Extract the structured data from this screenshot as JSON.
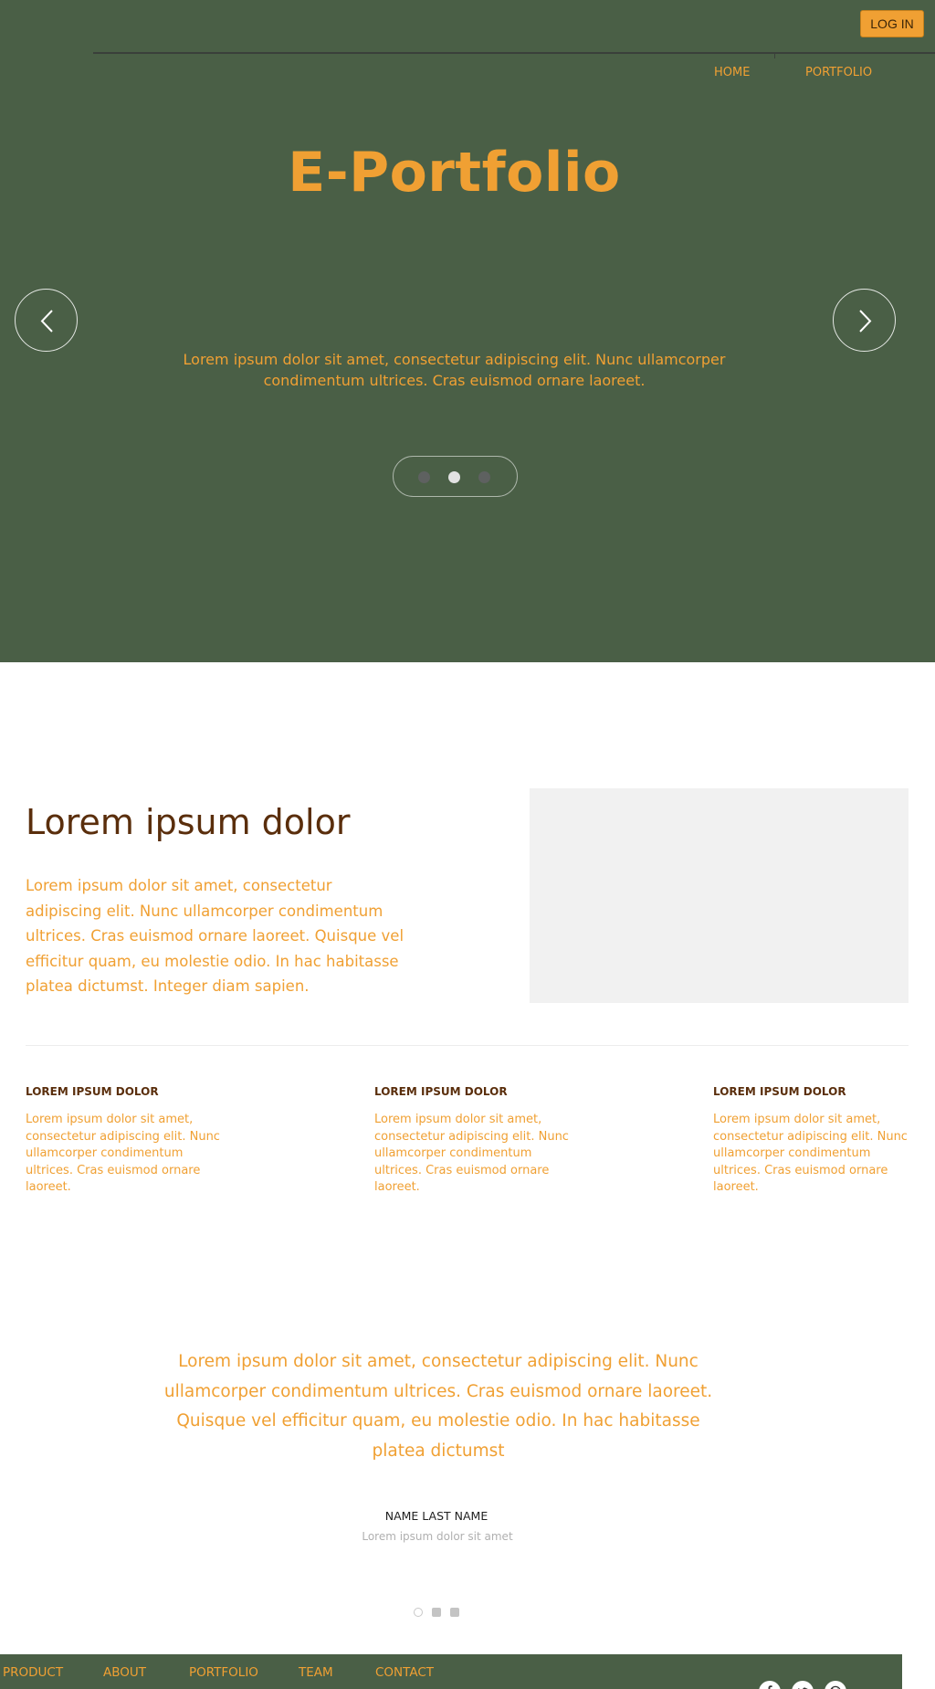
{
  "header": {
    "login_label": "LOG IN",
    "nav": [
      {
        "label": "HOME"
      },
      {
        "label": "PORTFOLIO"
      }
    ]
  },
  "hero": {
    "title": "E-Portfolio",
    "text": "Lorem ipsum dolor sit amet, consectetur adipiscing elit. Nunc ullamcorper condimentum ultrices. Cras euismod ornare laoreet.",
    "prev_icon": "chevron-left-icon",
    "next_icon": "chevron-right-icon",
    "slides_total": 3,
    "active_slide": 2
  },
  "intro": {
    "title": "Lorem ipsum dolor",
    "text": "Lorem ipsum dolor sit amet, consectetur adipiscing elit. Nunc ullamcorper condimentum ultrices. Cras euismod ornare laoreet. Quisque vel efficitur quam, eu molestie odio. In hac habitasse platea dictumst. Integer diam sapien."
  },
  "features": [
    {
      "heading": "LOREM IPSUM DOLOR",
      "text": "Lorem ipsum dolor sit amet, consectetur adipiscing elit. Nunc ullamcorper condimentum ultrices. Cras euismod ornare laoreet."
    },
    {
      "heading": "LOREM IPSUM DOLOR",
      "text": "Lorem ipsum dolor sit amet, consectetur adipiscing elit. Nunc ullamcorper condimentum ultrices. Cras euismod ornare laoreet."
    },
    {
      "heading": "LOREM IPSUM DOLOR",
      "text": "Lorem ipsum dolor sit amet, consectetur adipiscing elit. Nunc ullamcorper condimentum ultrices. Cras euismod ornare laoreet."
    }
  ],
  "testimonial": {
    "quote": "Lorem ipsum dolor sit amet, consectetur adipiscing elit. Nunc ullamcorper condimentum ultrices. Cras euismod ornare laoreet. Quisque vel efficitur quam, eu molestie odio. In hac habitasse platea dictumst",
    "name": "NAME LAST NAME",
    "role": "Lorem ipsum dolor sit amet",
    "slides_total": 3,
    "active_slide": 1
  },
  "footer": {
    "links": [
      {
        "label": "PRODUCT"
      },
      {
        "label": "ABOUT"
      },
      {
        "label": "PORTFOLIO"
      },
      {
        "label": "TEAM"
      },
      {
        "label": "CONTACT"
      }
    ],
    "social": [
      {
        "icon": "facebook-icon"
      },
      {
        "icon": "twitter-icon"
      },
      {
        "icon": "dribbble-icon"
      }
    ]
  },
  "colors": {
    "brand_green": "#4a5f46",
    "accent_orange": "#f0a033",
    "heading_brown": "#5a2e0c",
    "placeholder_gray": "#f1f1f1"
  }
}
